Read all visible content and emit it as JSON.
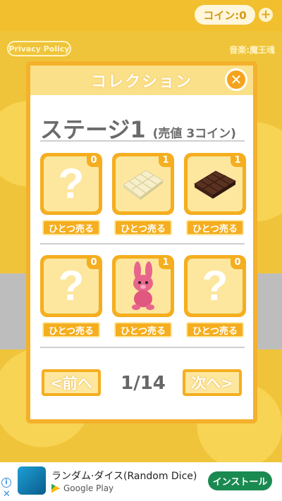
{
  "topbar": {
    "coins_label": "コイン:0",
    "plus_icon": "plus-icon"
  },
  "privacy_label": "Privacy Policy",
  "music_credit": "音楽:魔王魂",
  "modal": {
    "title": "コレクション",
    "close_icon": "close-icon",
    "stage_title": "ステージ1",
    "stage_price": "(売値 3コイン)",
    "items": [
      {
        "count": "0",
        "icon": "question-mark-icon",
        "unknown": true,
        "sell_label": "ひとつ売る"
      },
      {
        "count": "1",
        "icon": "white-chocolate-icon",
        "unknown": false,
        "sell_label": "ひとつ売る"
      },
      {
        "count": "1",
        "icon": "dark-chocolate-icon",
        "unknown": false,
        "sell_label": "ひとつ売る"
      },
      {
        "count": "0",
        "icon": "question-mark-icon",
        "unknown": true,
        "sell_label": "ひとつ売る"
      },
      {
        "count": "1",
        "icon": "pink-bunny-plush-icon",
        "unknown": false,
        "sell_label": "ひとつ売る"
      },
      {
        "count": "0",
        "icon": "question-mark-icon",
        "unknown": true,
        "sell_label": "ひとつ売る"
      }
    ],
    "question_mark": "?",
    "prev_label": "<前へ",
    "next_label": "次へ>",
    "page_indicator": "1/14"
  },
  "ad": {
    "title": "ランダム·ダイス(Random Dice)",
    "store": "Google Play",
    "install_label": "インストール",
    "info_icon": "info-icon",
    "close_icon": "close-icon"
  },
  "colors": {
    "accent": "#f5ae1f",
    "tile_fill": "#fde79e",
    "header": "#fbe08a",
    "install": "#1a8a50"
  }
}
